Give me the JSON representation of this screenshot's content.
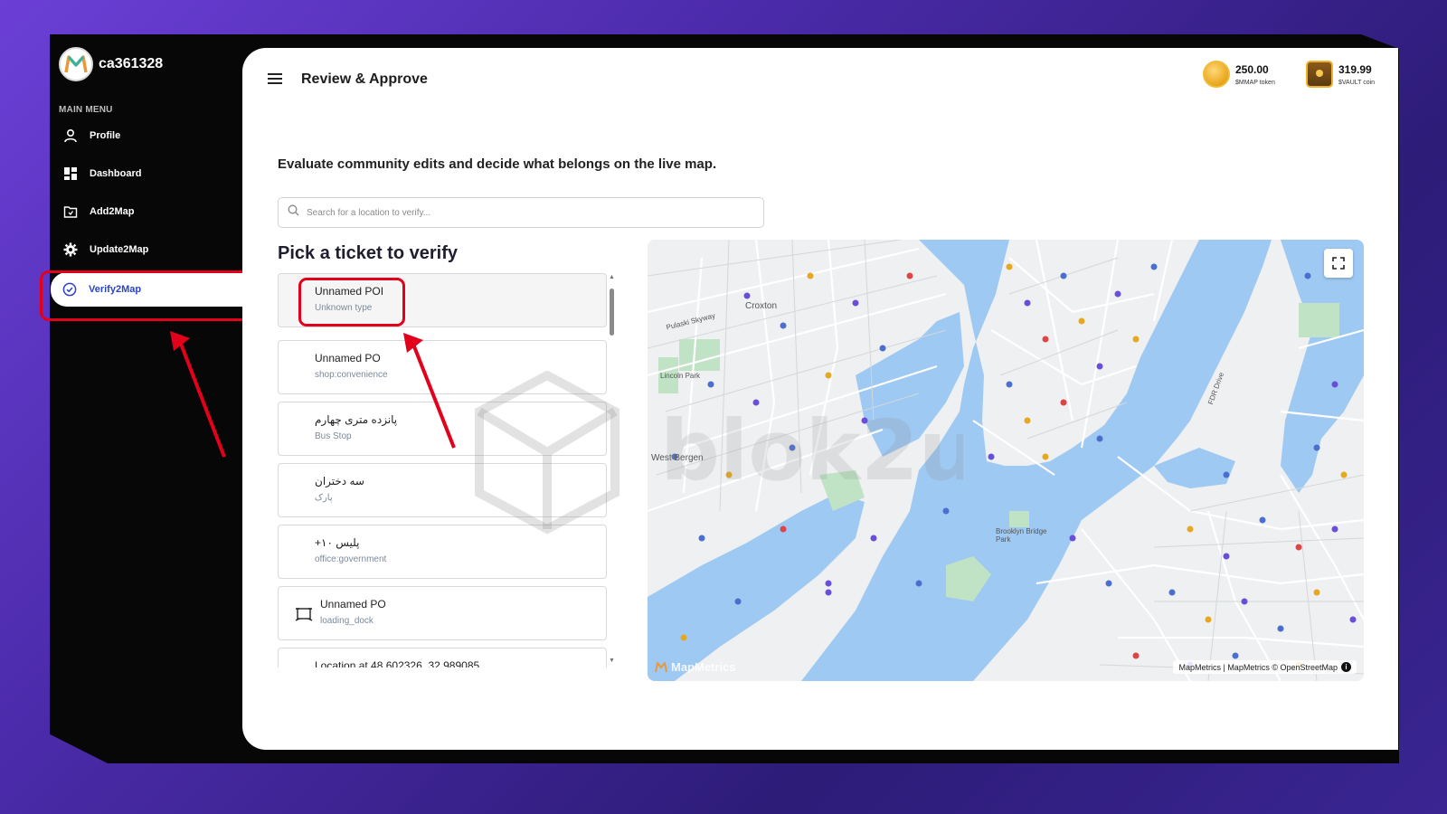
{
  "sidebar": {
    "username": "ca361328",
    "menu_title": "MAIN MENU",
    "items": [
      {
        "label": "Profile",
        "icon": "user-icon"
      },
      {
        "label": "Dashboard",
        "icon": "dashboard-icon"
      },
      {
        "label": "Add2Map",
        "icon": "add-map-icon"
      },
      {
        "label": "Update2Map",
        "icon": "gear-icon"
      },
      {
        "label": "Verify2Map",
        "icon": "check-circle-icon",
        "active": true
      }
    ]
  },
  "header": {
    "title": "Review & Approve",
    "tokens": [
      {
        "amount": "250.00",
        "unit": "$MMAP token",
        "icon": "coin-icon"
      },
      {
        "amount": "319.99",
        "unit": "$VAULT coin",
        "icon": "vault-icon"
      }
    ]
  },
  "main": {
    "subtitle": "Evaluate community edits and decide what belongs on the live map.",
    "search": {
      "placeholder": "Search for a location to verify...",
      "value": ""
    },
    "list_title": "Pick a ticket to verify",
    "tickets": [
      {
        "name": "Unnamed POI",
        "type": "Unknown type"
      },
      {
        "name": "Unnamed PO",
        "type": "shop:convenience"
      },
      {
        "name": "پانزده متری چهارم",
        "type": "Bus Stop"
      },
      {
        "name": "سه دختران",
        "type": "پارک"
      },
      {
        "name": "+پلیس ۱۰",
        "type": "office:government"
      },
      {
        "name": "Unnamed PO",
        "type": "loading_dock",
        "icon": "loading-dock-icon"
      },
      {
        "name": "Location at 48.602326, 32.989085",
        "type": ""
      }
    ]
  },
  "map": {
    "labels": [
      "Croxton",
      "Pulaski Skyway",
      "Lincoln Park",
      "West Bergen",
      "Brooklyn Bridge Park",
      "FDR Drive"
    ],
    "attribution": "MapMetrics | MapMetrics © OpenStreetMap",
    "logo": "MapMetrics",
    "colors": {
      "water": "#9ec9f2",
      "land": "#eef0f1",
      "park": "#bfe3c4"
    }
  },
  "watermark": "blok2u"
}
